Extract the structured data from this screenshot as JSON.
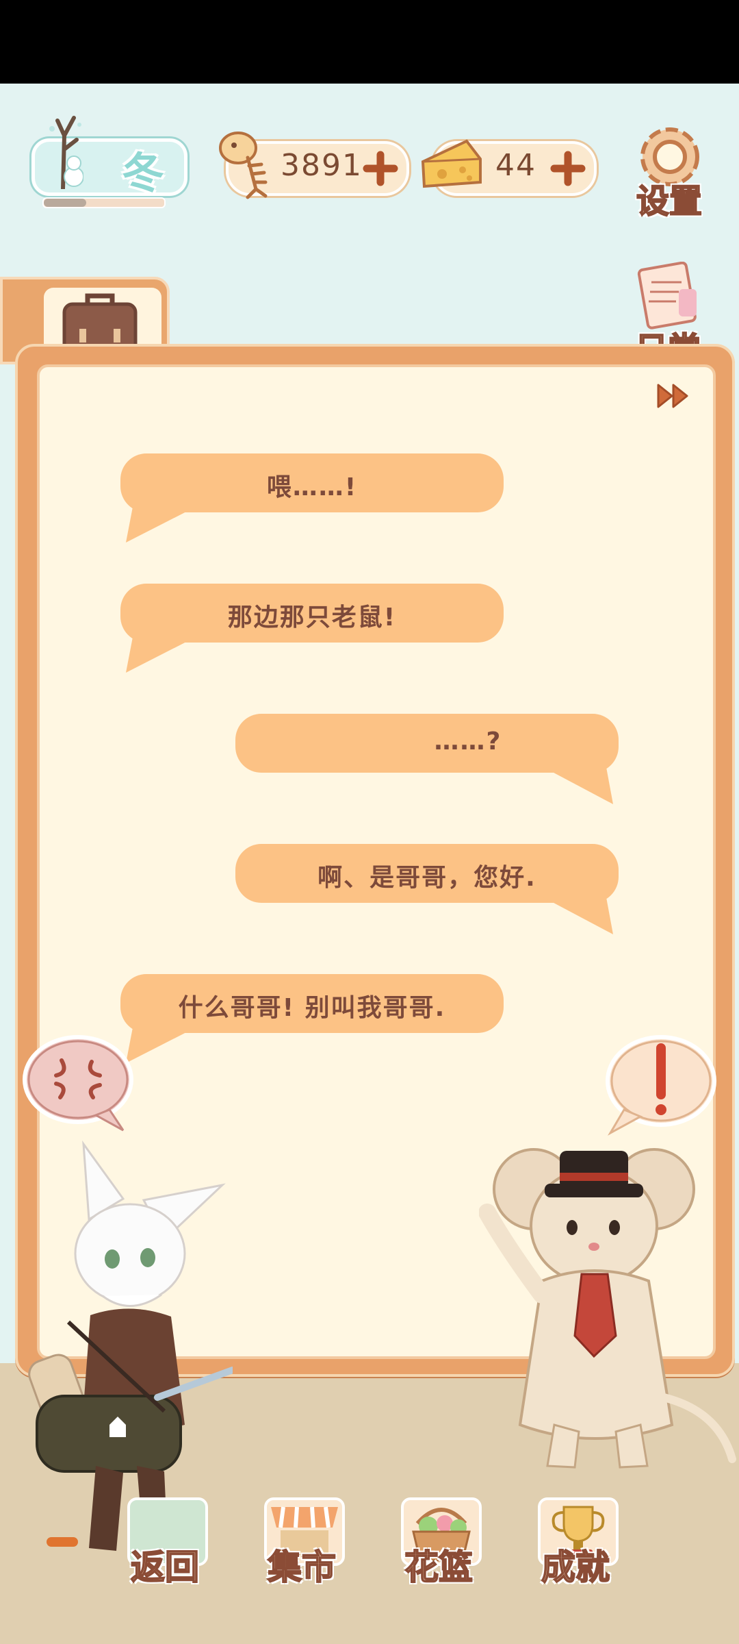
{
  "hud": {
    "season": {
      "label": "冬",
      "progress": 0.35,
      "icon": "snowman-tree-icon"
    },
    "fish_currency": {
      "value": "3891",
      "icon": "fish-bone-icon",
      "add_icon": "plus-icon"
    },
    "cheese_currency": {
      "value": "44",
      "icon": "cheese-icon",
      "add_icon": "plus-icon"
    },
    "settings": {
      "label": "设置",
      "icon": "gear-icon"
    },
    "daily": {
      "label": "日常",
      "icon": "tips-note-icon"
    }
  },
  "side_tab": {
    "icon": "briefcase-icon"
  },
  "dialog": {
    "skip_icon": "fast-forward-icon",
    "messages": [
      {
        "side": "left",
        "text": "喂……!"
      },
      {
        "side": "left",
        "text": "那边那只老鼠!"
      },
      {
        "side": "right",
        "text": "……?"
      },
      {
        "side": "right",
        "text": "啊、是哥哥，您好."
      },
      {
        "side": "left",
        "text": "什么哥哥! 别叫我哥哥."
      }
    ]
  },
  "characters": {
    "cat": {
      "emote": "anger-icon",
      "name": "white-cat-courier"
    },
    "mouse": {
      "emote": "exclamation-icon",
      "emote_text": "!",
      "name": "mouse-gentleman"
    }
  },
  "nav": {
    "items": [
      {
        "label": "返回",
        "icon": "back-scene-icon"
      },
      {
        "label": "集市",
        "icon": "market-stall-icon"
      },
      {
        "label": "花篮",
        "icon": "flower-basket-icon"
      },
      {
        "label": "成就",
        "icon": "trophy-icon"
      }
    ]
  },
  "colors": {
    "bubble": "#fcc285",
    "bubble_text": "#7d4a3a",
    "dialog_frame": "#e9a26a",
    "dialog_paper": "#fff7e2",
    "sky": "#e3f3f2",
    "ground": "#e0cfb0"
  }
}
